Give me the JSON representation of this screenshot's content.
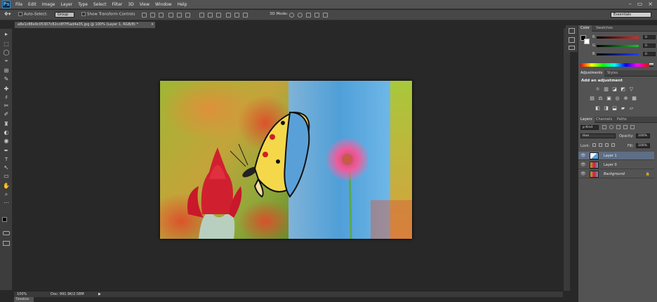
{
  "app": {
    "logo": "Ps"
  },
  "menu": [
    "File",
    "Edit",
    "Image",
    "Layer",
    "Type",
    "Select",
    "Filter",
    "3D",
    "View",
    "Window",
    "Help"
  ],
  "window_controls": [
    "–",
    "▭",
    "×"
  ],
  "options_bar": {
    "auto_select_label": "Auto-Select:",
    "auto_select_value": "Group",
    "show_transform_label": "Show Transform Controls",
    "mode_3d_label": "3D Mode:",
    "workspace": "Essentials"
  },
  "document": {
    "tab_title": "a8e1c88e9c05307c82cc8f7f5ad4a35.jpg @ 100% (Layer 1, RGB/8) *",
    "close": "×"
  },
  "status": {
    "zoom": "100%",
    "doc_info": "Doc: 991.9K/2.58M",
    "arrow": "▶"
  },
  "timeline_tab": "Timeline",
  "color_panel": {
    "tabs": [
      "Color",
      "Swatches"
    ],
    "rows": [
      {
        "label": "R",
        "value": "0",
        "color": "#d23b3b"
      },
      {
        "label": "G",
        "value": "0",
        "color": "#3bb34a"
      },
      {
        "label": "B",
        "value": "0",
        "color": "#3b55d2"
      }
    ]
  },
  "adjustments_panel": {
    "tabs": [
      "Adjustments",
      "Styles"
    ],
    "heading": "Add an adjustment",
    "icons_row1": [
      "☼",
      "▥",
      "◪",
      "◩",
      "▽"
    ],
    "icons_row2": [
      "▤",
      "⚖",
      "▣",
      "◎",
      "⊕",
      "▦"
    ],
    "icons_row3": [
      "◧",
      "◨",
      "⬓",
      "▰",
      "▱"
    ]
  },
  "layers_panel": {
    "tabs": [
      "Layers",
      "Channels",
      "Paths"
    ],
    "filter_kind": "ρ Kind",
    "blend_mode": "Hue",
    "opacity_label": "Opacity:",
    "opacity_value": "100%",
    "lock_label": "Lock:",
    "fill_label": "Fill:",
    "fill_value": "100%",
    "layers": [
      {
        "name": "Layer 1",
        "selected": true,
        "lock": ""
      },
      {
        "name": "Layer 0",
        "selected": false,
        "lock": ""
      },
      {
        "name": "Background",
        "selected": false,
        "lock": "🔒"
      }
    ]
  },
  "tools": [
    "▸",
    "⬚",
    "◯",
    "⌖",
    "⊞",
    "✎",
    "✚",
    "♯",
    "✂",
    "✐",
    "♜",
    "◐",
    "◉",
    "✒",
    "T",
    "↖",
    "▭",
    "✋",
    "⌕",
    "⋯"
  ],
  "colors": {
    "accent": "#2d8fd6",
    "panel": "#535353",
    "canvas": "#282828"
  }
}
